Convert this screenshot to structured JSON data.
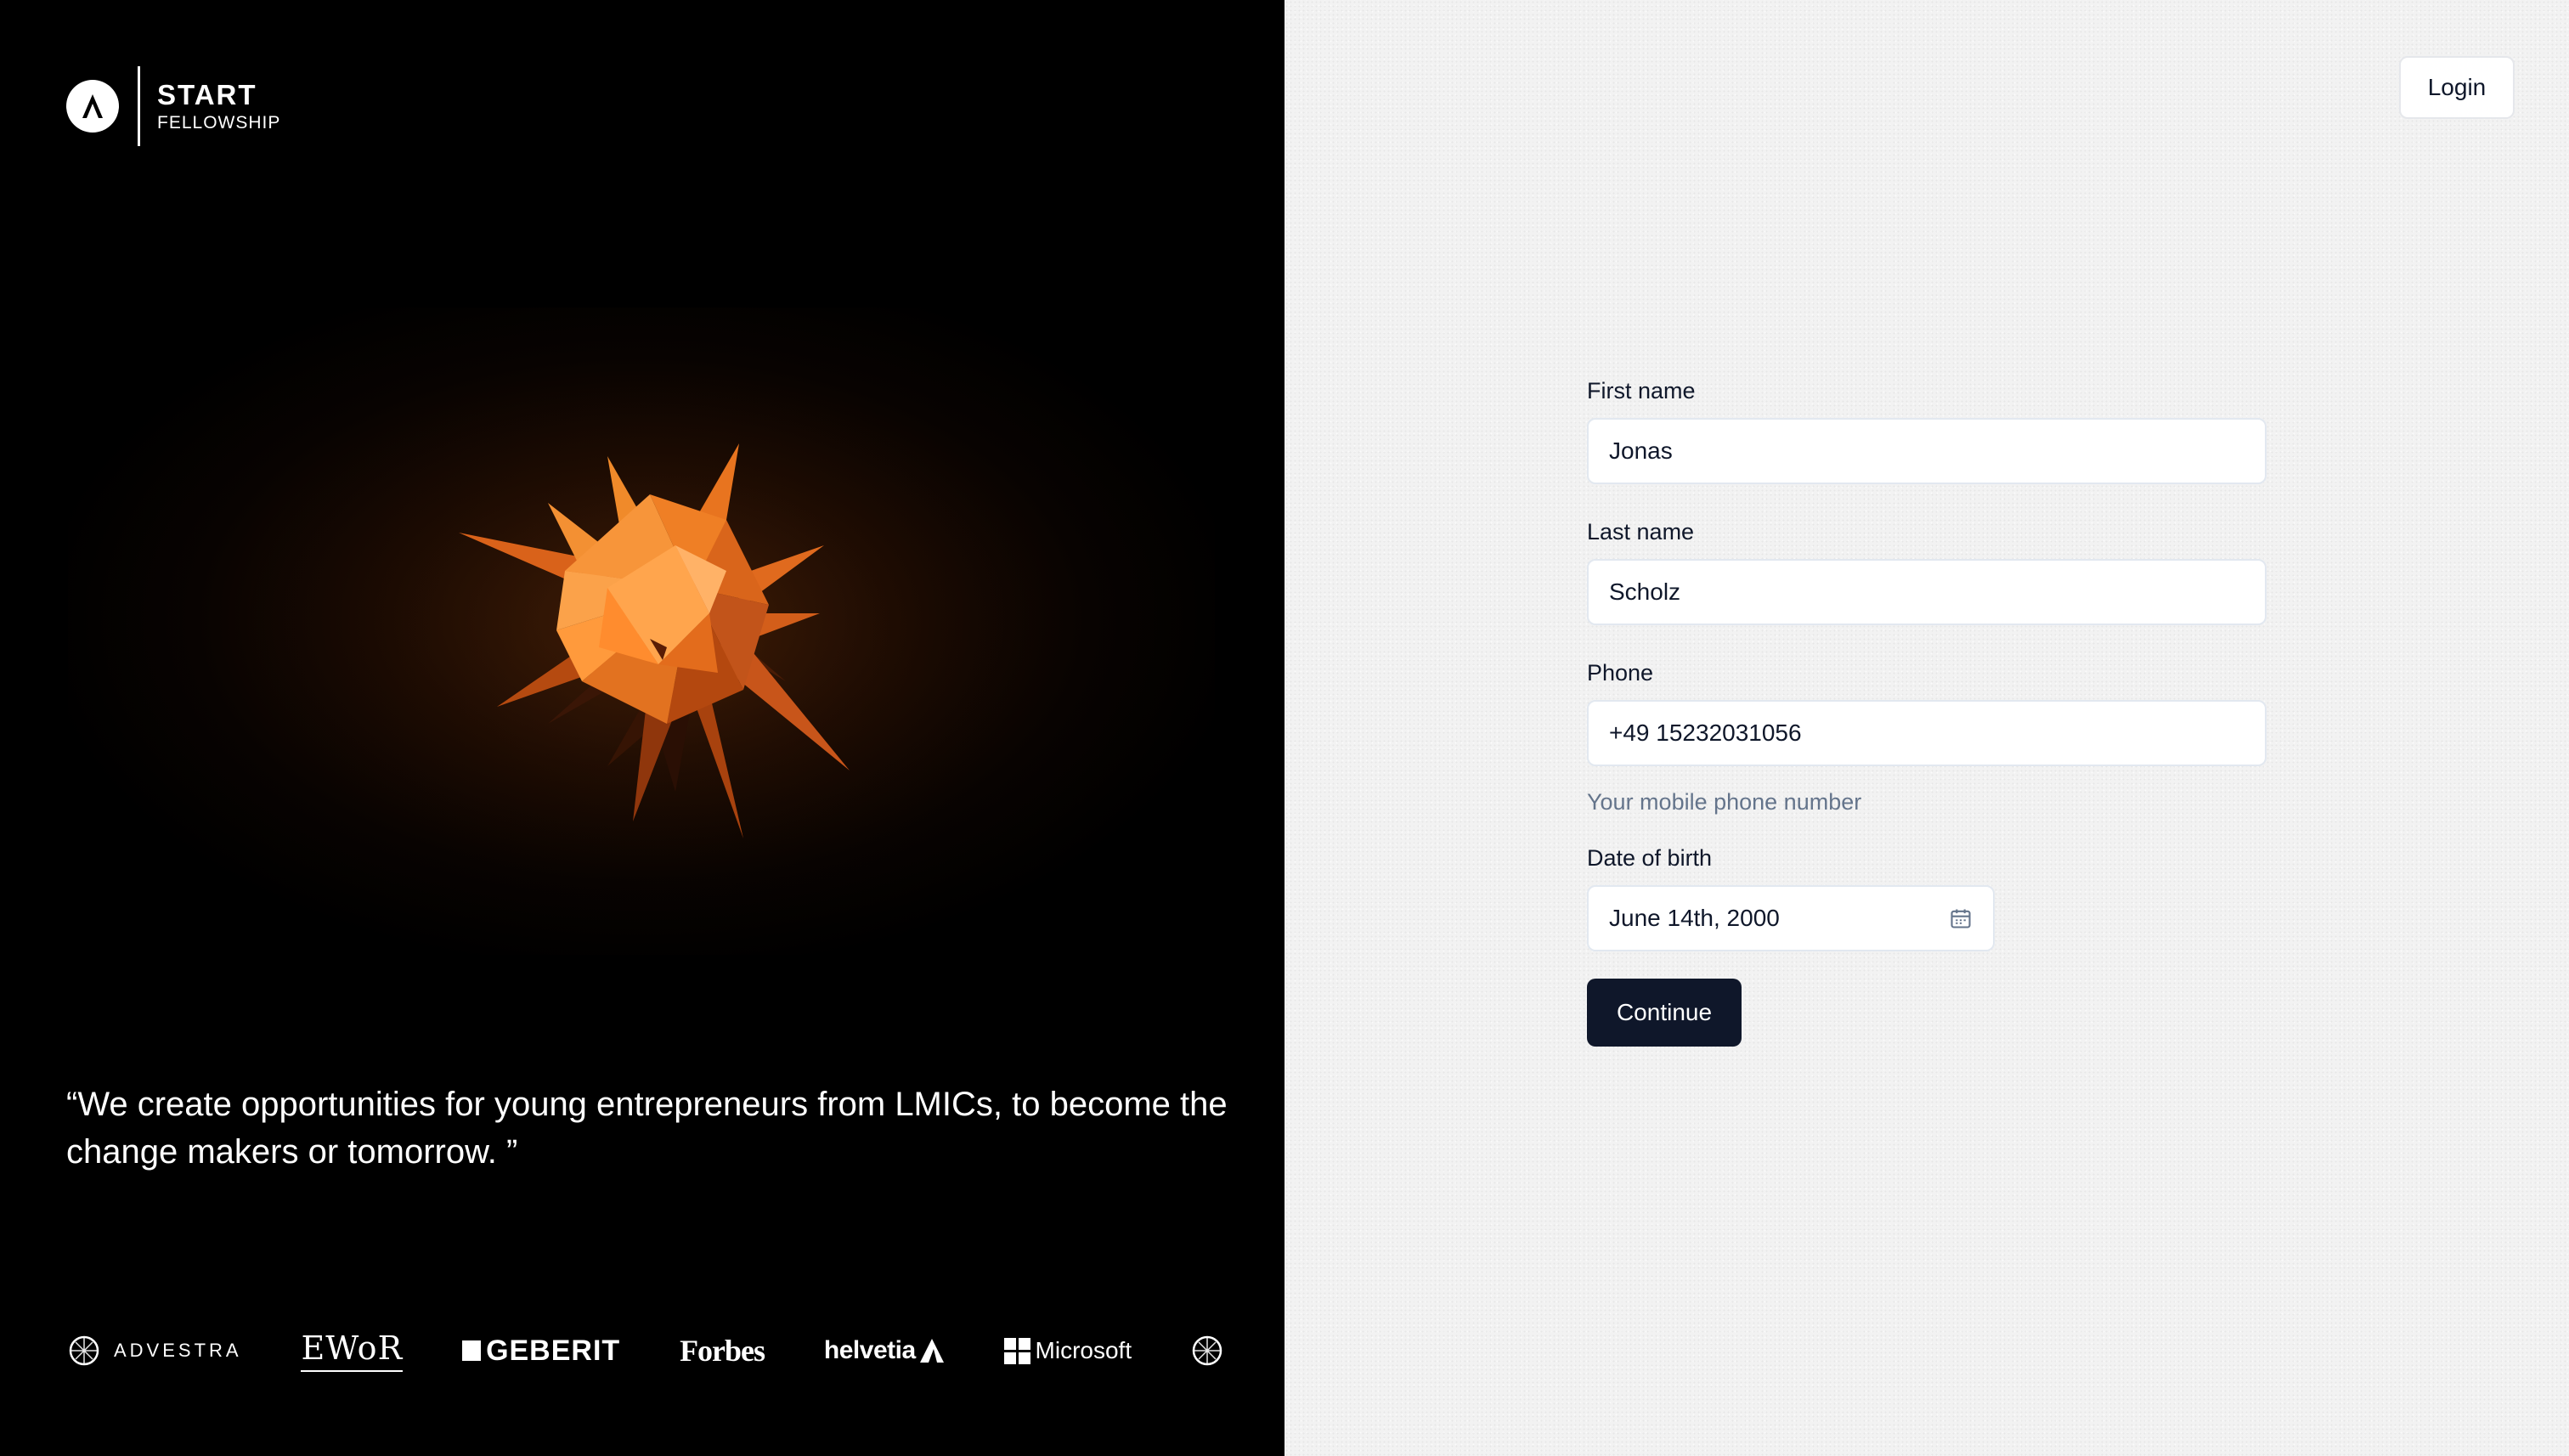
{
  "brand": {
    "title": "START",
    "subtitle": "FELLOWSHIP"
  },
  "hero": {
    "accent": "#f07a1a"
  },
  "quote": "“We create opportunities for young entrepreneurs from LMICs, to become the change makers or tomorrow. ”",
  "partners": {
    "advestra": "ADVESTRA",
    "ewor": "EWoR",
    "geberit": "GEBERIT",
    "forbes": "Forbes",
    "helvetia": "helvetia",
    "microsoft": "Microsoft"
  },
  "header": {
    "login_label": "Login"
  },
  "form": {
    "first_name": {
      "label": "First name",
      "value": "Jonas"
    },
    "last_name": {
      "label": "Last name",
      "value": "Scholz"
    },
    "phone": {
      "label": "Phone",
      "value": "+49 15232031056",
      "hint": "Your mobile phone number"
    },
    "dob": {
      "label": "Date of birth",
      "value": "June 14th, 2000",
      "icon": "calendar-icon"
    },
    "continue_label": "Continue"
  },
  "colors": {
    "left_bg": "#000000",
    "primary_button": "#0f172a",
    "hint_text": "#64748b"
  }
}
